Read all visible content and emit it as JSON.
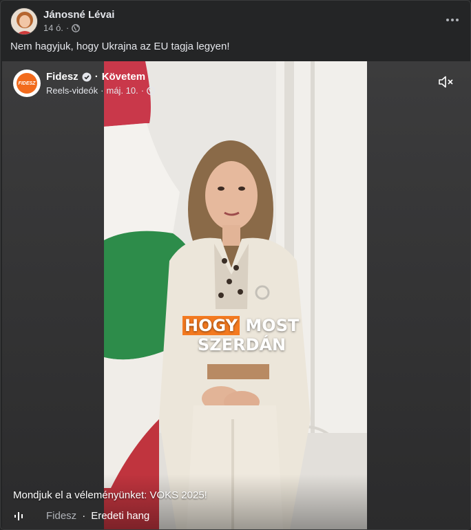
{
  "post": {
    "author": "Jánosné Lévai",
    "time": "14 ó.",
    "privacy_icon": "globe-icon",
    "text": "Nem hagyjuk, hogy Ukrajna az EU tagja legyen!"
  },
  "reel": {
    "page_name": "Fidesz",
    "logo_text": "FIDESZ",
    "follow_label": "Követem",
    "separator": "·",
    "type": "Reels-videók",
    "date": "máj. 10.",
    "caption_highlight": "HOGY",
    "caption_rest": "MOST",
    "caption_line2": "SZERDÁN",
    "description": "Mondjuk el a véleményünket: VOKS 2025!",
    "audio_page": "Fidesz",
    "audio_title": "Eredeti hang"
  },
  "colors": {
    "background": "#242526",
    "accent_orange": "#f47a20",
    "text_primary": "#e4e6eb",
    "text_secondary": "#b0b3b8"
  }
}
